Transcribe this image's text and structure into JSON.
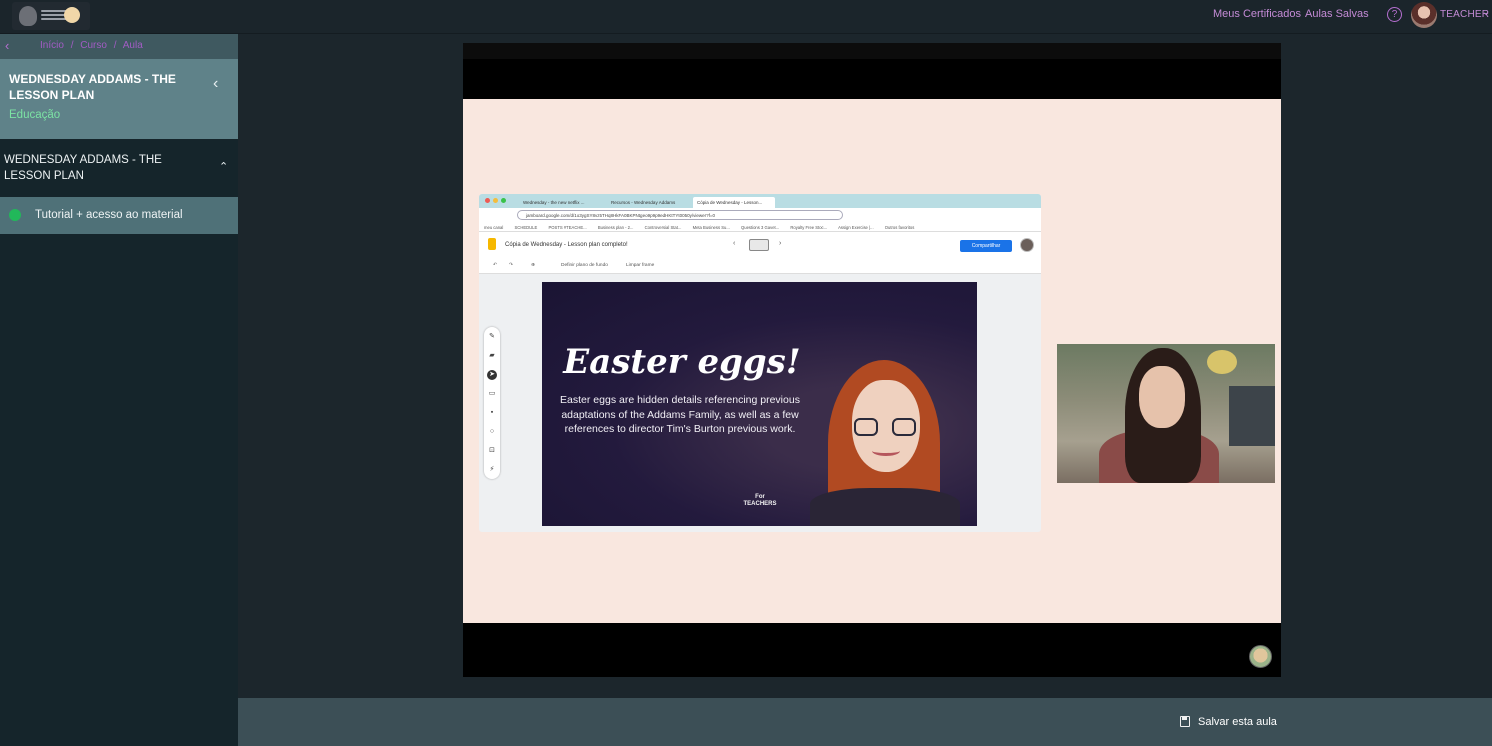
{
  "header": {
    "links": [
      "Meus Certificados",
      "Aulas Salvas"
    ],
    "help_icon": "?",
    "user_name": "TEACHER",
    "user_chevron": "⌄"
  },
  "sidebar": {
    "back_icon": "‹",
    "breadcrumb": [
      "Início",
      "/",
      "Curso",
      "/",
      "Aula"
    ],
    "course_title": "WEDNESDAY ADDAMS - THE LESSON PLAN",
    "course_category": "Educação",
    "collapse_icon": "‹",
    "module_title": "WEDNESDAY ADDAMS - THE LESSON PLAN",
    "module_chevron": "⌃",
    "lesson": "Tutorial + acesso ao material"
  },
  "video": {
    "browser": {
      "tabs": [
        "Wednesday - the new netflix ...",
        "Recursos - Wednesday Addams",
        "Cópia de Wednesday - Lesson..."
      ],
      "url": "jamboard.google.com/d/1o3ygSY8vz5THq8HkFA0BKPNtgeo9p9p9edHKtTYt0050y/viewer?f=0",
      "bookmarks": [
        "meu canal",
        "SCHEDULE",
        "POSTS #TEACHE...",
        "Business plan - 2...",
        "Controversial Stat...",
        "Meta Business Su...",
        "Questions 3 Gavet...",
        "Royalty Free Stoc...",
        "Assign Exercise |...",
        "Outros favoritos"
      ],
      "doc_title": "Cópia de Wednesday - Lesson plan completo!",
      "share_label": "Compartilhar",
      "toolbar_set_bg": "Definir plano de fundo",
      "toolbar_clear": "Limpar frame"
    },
    "slide": {
      "title": "Easter eggs!",
      "body": "Easter eggs are hidden details referencing previous adaptations of the Addams Family, as well as a few references to director Tim's Burton previous work.",
      "logo_top": "For",
      "logo_bottom": "TEACHERS"
    }
  },
  "footer": {
    "save_label": "Salvar esta aula"
  },
  "colors": {
    "accent": "#c48bd6",
    "sidebar_header": "#5f8289",
    "category": "#7ce3a4",
    "lesson_done": "#22b85a",
    "slide_bg": "#f9e7df"
  }
}
